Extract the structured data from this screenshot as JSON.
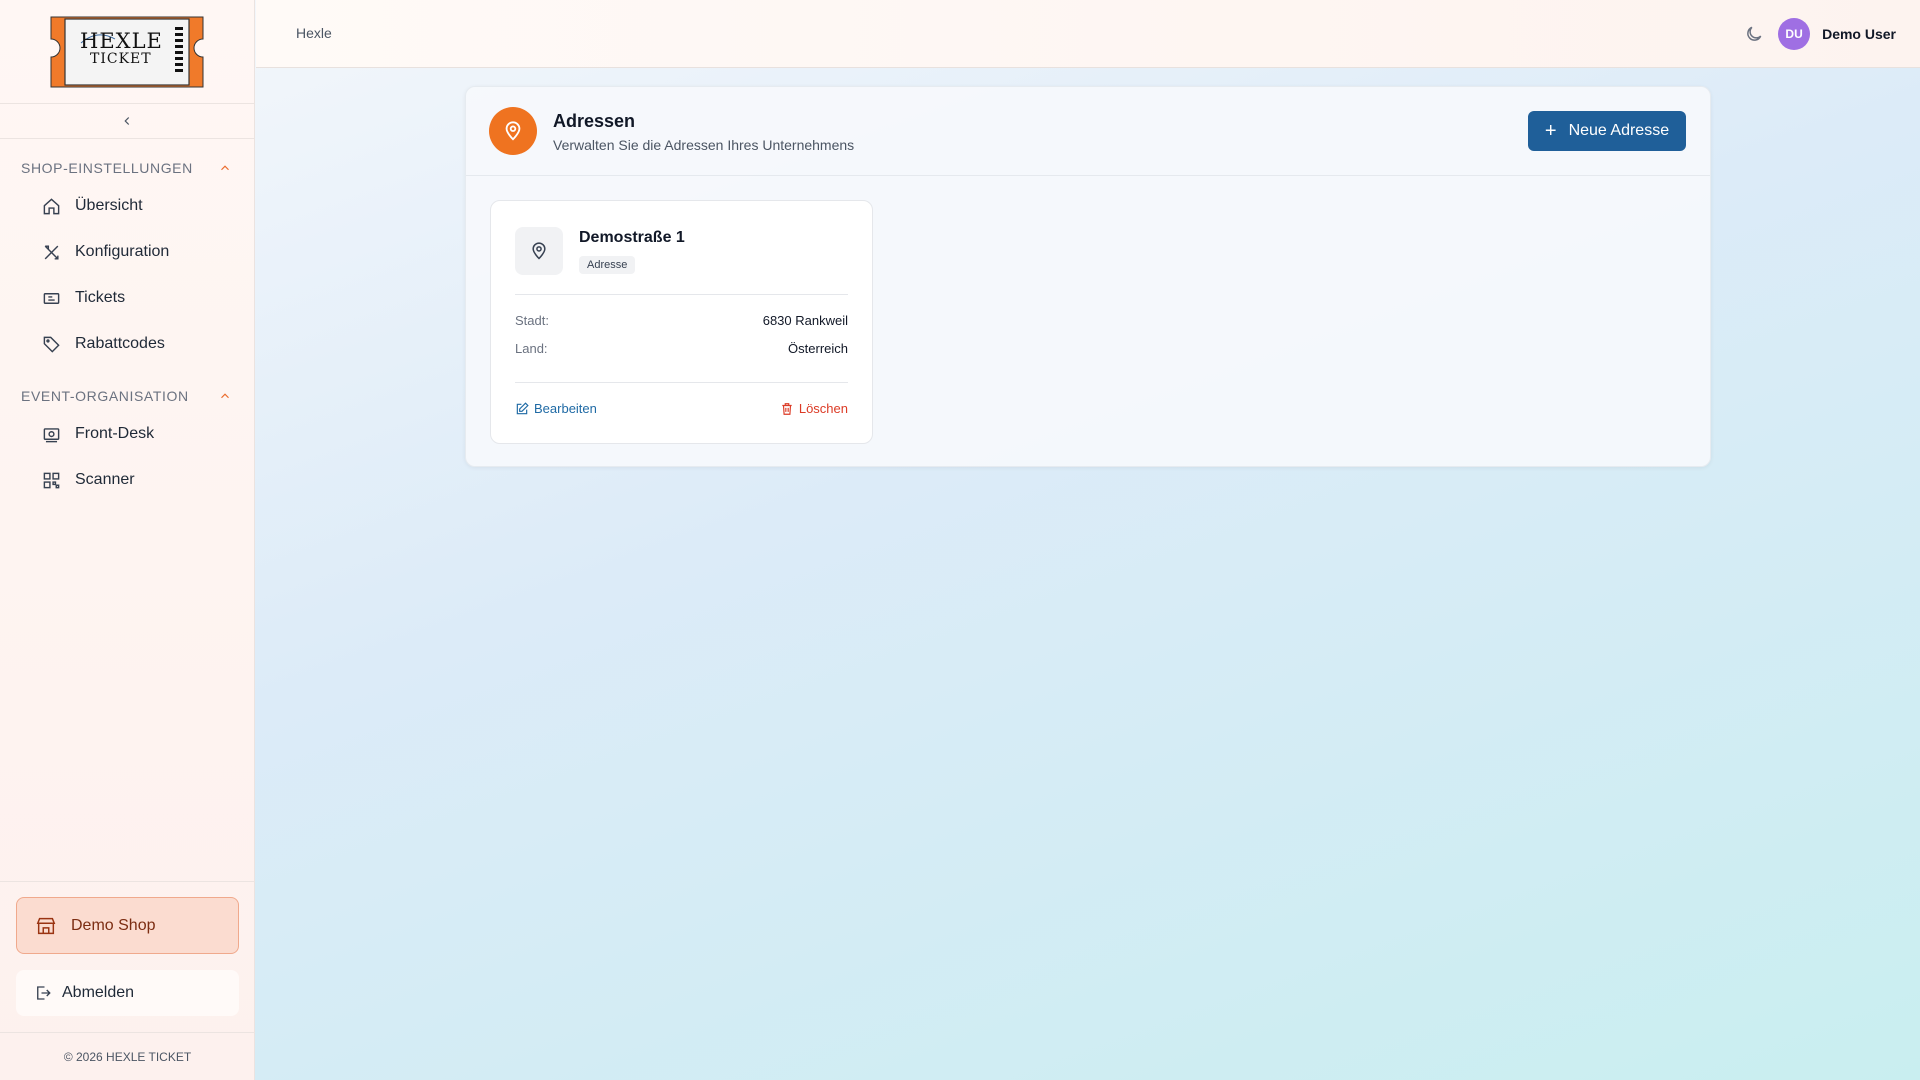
{
  "sidebar": {
    "logo_text_line1": "HEXLE",
    "logo_text_line2": "TICKET",
    "sections": [
      {
        "title": "SHOP-EINSTELLUNGEN",
        "items": [
          {
            "label": "Übersicht",
            "icon": "home-icon"
          },
          {
            "label": "Konfiguration",
            "icon": "tools-icon"
          },
          {
            "label": "Tickets",
            "icon": "ticket-icon"
          },
          {
            "label": "Rabattcodes",
            "icon": "tag-icon"
          }
        ]
      },
      {
        "title": "EVENT-ORGANISATION",
        "items": [
          {
            "label": "Front-Desk",
            "icon": "cash-register-icon"
          },
          {
            "label": "Scanner",
            "icon": "qr-code-icon"
          }
        ]
      }
    ],
    "shop_label": "Demo Shop",
    "logout_label": "Abmelden",
    "copyright": "© 2026 HEXLE TICKET"
  },
  "topbar": {
    "breadcrumb": "Hexle",
    "avatar_initials": "DU",
    "user_name": "Demo User"
  },
  "page": {
    "title": "Adressen",
    "subtitle": "Verwalten Sie die Adressen Ihres Unternehmens",
    "new_button_label": "Neue Adresse"
  },
  "address_card": {
    "title": "Demostraße 1",
    "tag": "Adresse",
    "fields": [
      {
        "key": "Stadt:",
        "value": "6830 Rankweil"
      },
      {
        "key": "Land:",
        "value": "Österreich"
      }
    ],
    "edit_label": "Bearbeiten",
    "delete_label": "Löschen"
  },
  "colors": {
    "accent_orange": "#ef7320",
    "primary_blue": "#1f5f99",
    "delete_red": "#dc3b26",
    "avatar_purple": "#9f6fe3"
  }
}
